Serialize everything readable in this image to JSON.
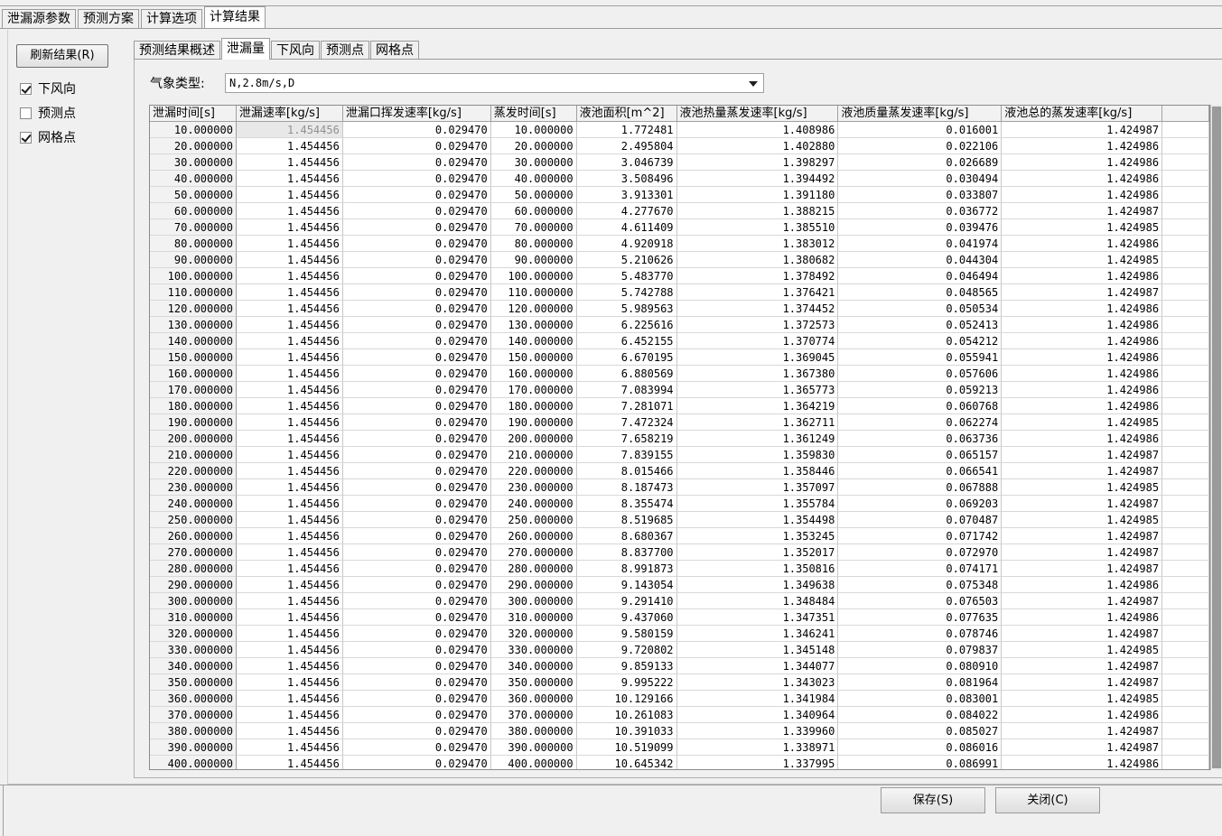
{
  "top_tabs": [
    "泄漏源参数",
    "预测方案",
    "计算选项",
    "计算结果"
  ],
  "sidebar": {
    "refresh_label": "刷新结果(R)",
    "checks": [
      {
        "label": "下风向",
        "checked": true
      },
      {
        "label": "预测点",
        "checked": false
      },
      {
        "label": "网格点",
        "checked": true
      }
    ]
  },
  "inner_tabs": [
    "预测结果概述",
    "泄漏量",
    "下风向",
    "预测点",
    "网格点"
  ],
  "weather": {
    "label": "气象类型:",
    "value": "N,2.8m/s,D"
  },
  "table": {
    "columns": [
      "泄漏时间[s]",
      "泄漏速率[kg/s]",
      "泄漏口挥发速率[kg/s]",
      "蒸发时间[s]",
      "液池面积[m^2]",
      "液池热量蒸发速率[kg/s]",
      "液池质量蒸发速率[kg/s]",
      "液池总的蒸发速率[kg/s]"
    ],
    "rows": [
      [
        "10.000000",
        "1.454456",
        "0.029470",
        "10.000000",
        "1.772481",
        "1.408986",
        "0.016001",
        "1.424987"
      ],
      [
        "20.000000",
        "1.454456",
        "0.029470",
        "20.000000",
        "2.495804",
        "1.402880",
        "0.022106",
        "1.424986"
      ],
      [
        "30.000000",
        "1.454456",
        "0.029470",
        "30.000000",
        "3.046739",
        "1.398297",
        "0.026689",
        "1.424986"
      ],
      [
        "40.000000",
        "1.454456",
        "0.029470",
        "40.000000",
        "3.508496",
        "1.394492",
        "0.030494",
        "1.424986"
      ],
      [
        "50.000000",
        "1.454456",
        "0.029470",
        "50.000000",
        "3.913301",
        "1.391180",
        "0.033807",
        "1.424986"
      ],
      [
        "60.000000",
        "1.454456",
        "0.029470",
        "60.000000",
        "4.277670",
        "1.388215",
        "0.036772",
        "1.424987"
      ],
      [
        "70.000000",
        "1.454456",
        "0.029470",
        "70.000000",
        "4.611409",
        "1.385510",
        "0.039476",
        "1.424985"
      ],
      [
        "80.000000",
        "1.454456",
        "0.029470",
        "80.000000",
        "4.920918",
        "1.383012",
        "0.041974",
        "1.424986"
      ],
      [
        "90.000000",
        "1.454456",
        "0.029470",
        "90.000000",
        "5.210626",
        "1.380682",
        "0.044304",
        "1.424985"
      ],
      [
        "100.000000",
        "1.454456",
        "0.029470",
        "100.000000",
        "5.483770",
        "1.378492",
        "0.046494",
        "1.424986"
      ],
      [
        "110.000000",
        "1.454456",
        "0.029470",
        "110.000000",
        "5.742788",
        "1.376421",
        "0.048565",
        "1.424987"
      ],
      [
        "120.000000",
        "1.454456",
        "0.029470",
        "120.000000",
        "5.989563",
        "1.374452",
        "0.050534",
        "1.424986"
      ],
      [
        "130.000000",
        "1.454456",
        "0.029470",
        "130.000000",
        "6.225616",
        "1.372573",
        "0.052413",
        "1.424986"
      ],
      [
        "140.000000",
        "1.454456",
        "0.029470",
        "140.000000",
        "6.452155",
        "1.370774",
        "0.054212",
        "1.424986"
      ],
      [
        "150.000000",
        "1.454456",
        "0.029470",
        "150.000000",
        "6.670195",
        "1.369045",
        "0.055941",
        "1.424986"
      ],
      [
        "160.000000",
        "1.454456",
        "0.029470",
        "160.000000",
        "6.880569",
        "1.367380",
        "0.057606",
        "1.424986"
      ],
      [
        "170.000000",
        "1.454456",
        "0.029470",
        "170.000000",
        "7.083994",
        "1.365773",
        "0.059213",
        "1.424986"
      ],
      [
        "180.000000",
        "1.454456",
        "0.029470",
        "180.000000",
        "7.281071",
        "1.364219",
        "0.060768",
        "1.424986"
      ],
      [
        "190.000000",
        "1.454456",
        "0.029470",
        "190.000000",
        "7.472324",
        "1.362711",
        "0.062274",
        "1.424985"
      ],
      [
        "200.000000",
        "1.454456",
        "0.029470",
        "200.000000",
        "7.658219",
        "1.361249",
        "0.063736",
        "1.424986"
      ],
      [
        "210.000000",
        "1.454456",
        "0.029470",
        "210.000000",
        "7.839155",
        "1.359830",
        "0.065157",
        "1.424987"
      ],
      [
        "220.000000",
        "1.454456",
        "0.029470",
        "220.000000",
        "8.015466",
        "1.358446",
        "0.066541",
        "1.424987"
      ],
      [
        "230.000000",
        "1.454456",
        "0.029470",
        "230.000000",
        "8.187473",
        "1.357097",
        "0.067888",
        "1.424985"
      ],
      [
        "240.000000",
        "1.454456",
        "0.029470",
        "240.000000",
        "8.355474",
        "1.355784",
        "0.069203",
        "1.424987"
      ],
      [
        "250.000000",
        "1.454456",
        "0.029470",
        "250.000000",
        "8.519685",
        "1.354498",
        "0.070487",
        "1.424985"
      ],
      [
        "260.000000",
        "1.454456",
        "0.029470",
        "260.000000",
        "8.680367",
        "1.353245",
        "0.071742",
        "1.424987"
      ],
      [
        "270.000000",
        "1.454456",
        "0.029470",
        "270.000000",
        "8.837700",
        "1.352017",
        "0.072970",
        "1.424987"
      ],
      [
        "280.000000",
        "1.454456",
        "0.029470",
        "280.000000",
        "8.991873",
        "1.350816",
        "0.074171",
        "1.424987"
      ],
      [
        "290.000000",
        "1.454456",
        "0.029470",
        "290.000000",
        "9.143054",
        "1.349638",
        "0.075348",
        "1.424986"
      ],
      [
        "300.000000",
        "1.454456",
        "0.029470",
        "300.000000",
        "9.291410",
        "1.348484",
        "0.076503",
        "1.424987"
      ],
      [
        "310.000000",
        "1.454456",
        "0.029470",
        "310.000000",
        "9.437060",
        "1.347351",
        "0.077635",
        "1.424986"
      ],
      [
        "320.000000",
        "1.454456",
        "0.029470",
        "320.000000",
        "9.580159",
        "1.346241",
        "0.078746",
        "1.424987"
      ],
      [
        "330.000000",
        "1.454456",
        "0.029470",
        "330.000000",
        "9.720802",
        "1.345148",
        "0.079837",
        "1.424985"
      ],
      [
        "340.000000",
        "1.454456",
        "0.029470",
        "340.000000",
        "9.859133",
        "1.344077",
        "0.080910",
        "1.424987"
      ],
      [
        "350.000000",
        "1.454456",
        "0.029470",
        "350.000000",
        "9.995222",
        "1.343023",
        "0.081964",
        "1.424987"
      ],
      [
        "360.000000",
        "1.454456",
        "0.029470",
        "360.000000",
        "10.129166",
        "1.341984",
        "0.083001",
        "1.424985"
      ],
      [
        "370.000000",
        "1.454456",
        "0.029470",
        "370.000000",
        "10.261083",
        "1.340964",
        "0.084022",
        "1.424986"
      ],
      [
        "380.000000",
        "1.454456",
        "0.029470",
        "380.000000",
        "10.391033",
        "1.339960",
        "0.085027",
        "1.424987"
      ],
      [
        "390.000000",
        "1.454456",
        "0.029470",
        "390.000000",
        "10.519099",
        "1.338971",
        "0.086016",
        "1.424987"
      ],
      [
        "400.000000",
        "1.454456",
        "0.029470",
        "400.000000",
        "10.645342",
        "1.337995",
        "0.086991",
        "1.424986"
      ]
    ]
  },
  "buttons": {
    "save": "保存(S)",
    "close": "关闭(C)"
  }
}
